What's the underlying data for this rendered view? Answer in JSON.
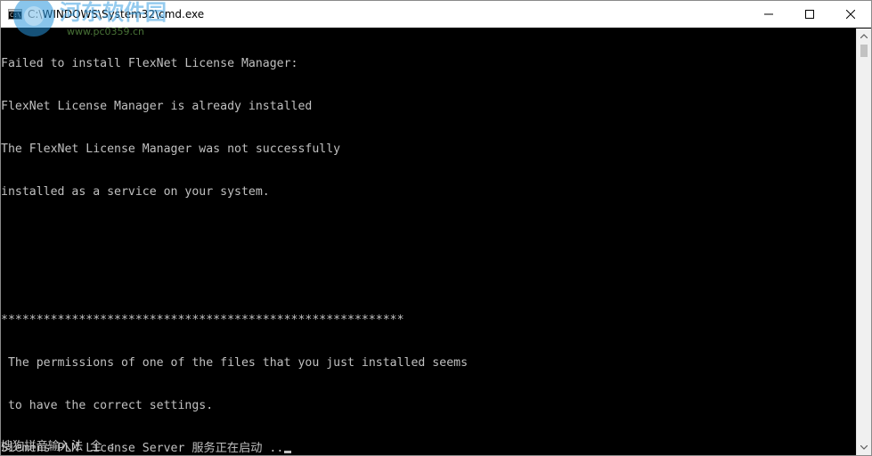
{
  "window": {
    "title": "C:\\WINDOWS\\System32\\cmd.exe",
    "icon": "cmd-icon",
    "icon_glyph": "C:\\",
    "controls": {
      "minimize": "minimize-icon",
      "maximize": "maximize-icon",
      "close": "close-icon"
    }
  },
  "console": {
    "lines": [
      "Failed to install FlexNet License Manager:",
      "FlexNet License Manager is already installed",
      "The FlexNet License Manager was not successfully",
      "installed as a service on your system.",
      "",
      "",
      "*********************************************************",
      " The permissions of one of the files that you just installed seems",
      " to have the correct settings.",
      "Siemens PLM License Server 服务正在启动 .."
    ],
    "ime_status": "搜狗拼音输入法 全 :",
    "text_color": "#c0c0c0",
    "background": "#000000"
  },
  "watermark": {
    "text": "河东软件园",
    "subtext": "www.pc0359.cn"
  },
  "scrollbar": {
    "up_icon": "scroll-up-icon",
    "down_icon": "scroll-down-icon"
  }
}
